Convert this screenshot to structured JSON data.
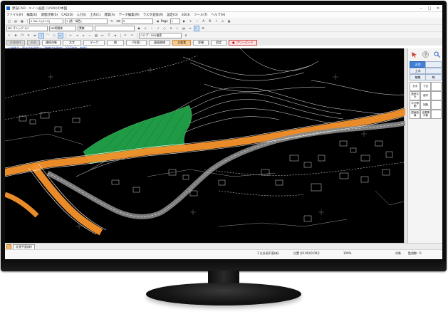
{
  "window": {
    "title": "建設CAD - メイン画面 (1/500)の本図"
  },
  "menu": [
    "ファイル(F)",
    "編集(E)",
    "測量計算(S)",
    "CAD(D)",
    "入力(I)",
    "土木(C)",
    "建築(A)",
    "データ編集(M)",
    "ラスタ変換(R)",
    "設定(O)",
    "3D(3)",
    "ツール(T)",
    "ヘルプ(H)"
  ],
  "toolbar1": {
    "layer_combo": "1 Pen 1 [0.13]",
    "color_combo": "1 (黒・緑色)",
    "scale_combo": "0",
    "page_label": "Page",
    "page_value": "1"
  },
  "toolbar2": {
    "font_combo": "MS ゴシック 1/1",
    "style_combo": "MS明朝体",
    "size_combo": "実線",
    "help_search": "ヘルプ・FAQ検索"
  },
  "command_bar": {
    "grey_label_1": "作業操作",
    "grey_label_2": "前面",
    "buttons": [
      "連続対象",
      "文字",
      "マーク",
      "線",
      "円(弧)",
      "図面曲線",
      "全要素",
      "詳細",
      "設定"
    ],
    "active_index": 6,
    "free_button": "フリーパーツ"
  },
  "prompt": "＜始終点・弧の点を指定＞［曲線点を指定］［CV]追加・削除］",
  "right_panel": {
    "tabs": [
      "汎用",
      "土木",
      "編集",
      "線"
    ],
    "active_tab": 0,
    "buttons": [
      "文字",
      "寸法",
      "連続平行",
      "複写",
      "平行移動",
      "回転",
      "図面曲線",
      "全要素対象"
    ]
  },
  "sheet_tabs": [
    "計画平面(新)"
  ],
  "status": {
    "left": "1 仕計画平面(新)",
    "coordinates": "位置 [(0.00)(0.00)]",
    "zoom": "100%",
    "right_label": "対象",
    "right_count": "監視数：0"
  },
  "colors": {
    "accent": "#3e7fd8",
    "road_highlight": "#f5922b",
    "green_area": "#1f9a45",
    "cad_background": "#000000"
  },
  "icons": [
    "red-pointer-icon",
    "help-question-icon",
    "search-magnifier-icon"
  ]
}
